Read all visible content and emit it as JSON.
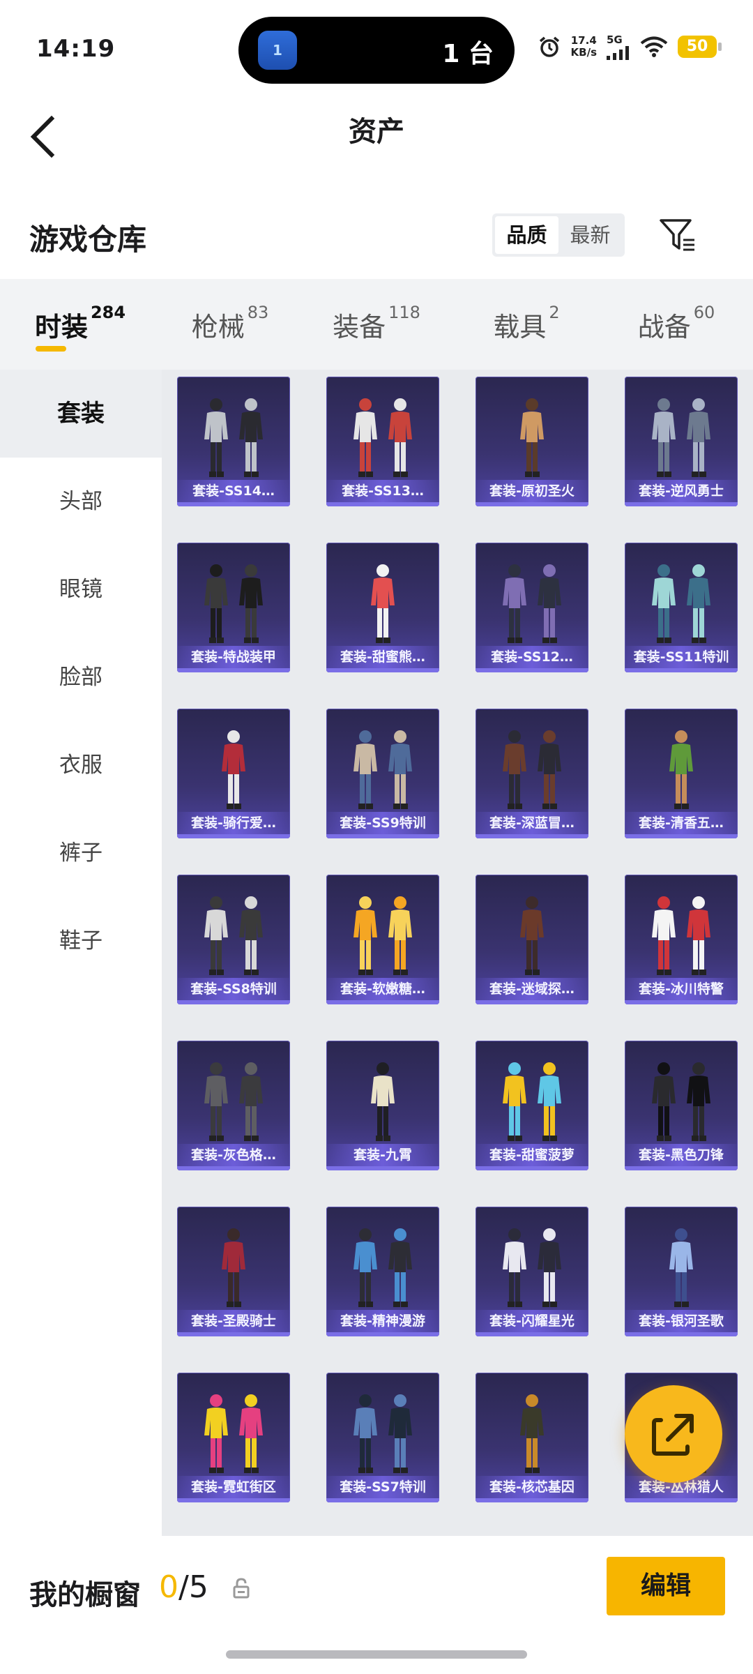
{
  "status_bar": {
    "time": "14:19",
    "island_badge": "1",
    "island_text": "1 台",
    "net_speed_value": "17.4",
    "net_speed_unit": "KB/s",
    "network": "5G",
    "battery": "50"
  },
  "header": {
    "title": "资产"
  },
  "warehouse": {
    "title": "游戏仓库",
    "sort_options": [
      "品质",
      "最新"
    ],
    "sort_active": "品质"
  },
  "tabs": [
    {
      "label": "时装",
      "count": "284",
      "active": true
    },
    {
      "label": "枪械",
      "count": "83",
      "active": false
    },
    {
      "label": "装备",
      "count": "118",
      "active": false
    },
    {
      "label": "载具",
      "count": "2",
      "active": false
    },
    {
      "label": "战备",
      "count": "60",
      "active": false
    }
  ],
  "sidebar": {
    "items": [
      {
        "label": "套装",
        "active": true
      },
      {
        "label": "头部",
        "active": false
      },
      {
        "label": "眼镜",
        "active": false
      },
      {
        "label": "脸部",
        "active": false
      },
      {
        "label": "衣服",
        "active": false
      },
      {
        "label": "裤子",
        "active": false
      },
      {
        "label": "鞋子",
        "active": false
      }
    ]
  },
  "items": [
    {
      "label": "套装-SS14…",
      "colors": [
        "#bfc3c9",
        "#2a2a30"
      ]
    },
    {
      "label": "套装-SS13…",
      "colors": [
        "#e6e6e6",
        "#c8433b"
      ]
    },
    {
      "label": "套装-原初圣火",
      "colors": [
        "#cf9a63",
        "#5a3b2a"
      ]
    },
    {
      "label": "套装-逆风勇士",
      "colors": [
        "#a9b3c6",
        "#6d7a8f"
      ]
    },
    {
      "label": "套装-特战装甲",
      "colors": [
        "#3a3a3a",
        "#1d1d1d"
      ]
    },
    {
      "label": "套装-甜蜜熊…",
      "colors": [
        "#e35050",
        "#f2f2f2"
      ]
    },
    {
      "label": "套装-SS12…",
      "colors": [
        "#7f6eb3",
        "#2d3140"
      ]
    },
    {
      "label": "套装-SS11特训",
      "colors": [
        "#9ed6d6",
        "#3c6f8a"
      ]
    },
    {
      "label": "套装-骑行爱…",
      "colors": [
        "#b32d3a",
        "#e8e8e8"
      ]
    },
    {
      "label": "套装-SS9特训",
      "colors": [
        "#c9b9a4",
        "#4f6b9a"
      ]
    },
    {
      "label": "套装-深蓝冒…",
      "colors": [
        "#6a3d2d",
        "#2b2b35"
      ]
    },
    {
      "label": "套装-清香五…",
      "colors": [
        "#5f9a3a",
        "#c58d5a"
      ]
    },
    {
      "label": "套装-SS8特训",
      "colors": [
        "#d8d8d8",
        "#3a3a3a"
      ]
    },
    {
      "label": "套装-软嫩糖…",
      "colors": [
        "#f5a623",
        "#f7d25a"
      ]
    },
    {
      "label": "套装-迷域探…",
      "colors": [
        "#6b3a2a",
        "#3d2b2b"
      ]
    },
    {
      "label": "套装-冰川特警",
      "colors": [
        "#f4f4f4",
        "#d0353a"
      ]
    },
    {
      "label": "套装-灰色格…",
      "colors": [
        "#5e5e62",
        "#3b3b3e"
      ]
    },
    {
      "label": "套装-九霄",
      "colors": [
        "#e9e2c8",
        "#1f1f24"
      ]
    },
    {
      "label": "套装-甜蜜菠萝",
      "colors": [
        "#f2c21f",
        "#5fc7e6"
      ]
    },
    {
      "label": "套装-黑色刀锋",
      "colors": [
        "#2a2a2e",
        "#111114"
      ]
    },
    {
      "label": "套装-圣殿骑士",
      "colors": [
        "#a02a3a",
        "#3a2a2a"
      ]
    },
    {
      "label": "套装-精神漫游",
      "colors": [
        "#4a8fd0",
        "#2d2d35"
      ]
    },
    {
      "label": "套装-闪耀星光",
      "colors": [
        "#e8e8f0",
        "#2b2b3a"
      ]
    },
    {
      "label": "套装-银河圣歌",
      "colors": [
        "#9ab6e8",
        "#3e4f8e"
      ]
    },
    {
      "label": "套装-霓虹街区",
      "colors": [
        "#f2d021",
        "#e54080"
      ]
    },
    {
      "label": "套装-SS7特训",
      "colors": [
        "#5a7fb8",
        "#1f2a3a"
      ]
    },
    {
      "label": "套装-核芯基因",
      "colors": [
        "#3a3a2a",
        "#c98a2a"
      ]
    },
    {
      "label": "套装-丛林猎人",
      "colors": [
        "#6a7a3a",
        "#3a3a2a"
      ]
    }
  ],
  "bottom_bar": {
    "title": "我的橱窗",
    "used": "0",
    "sep_total": "/5",
    "edit_label": "编辑"
  },
  "colors": {
    "accent": "#f5b800",
    "card_bg": "#3a3370",
    "card_label": "#6e5fdc"
  },
  "icons": {
    "back": "chevron-left-icon",
    "filter": "filter-icon",
    "share": "share-out-icon",
    "lock": "lock-icon",
    "alarm": "alarm-icon",
    "wifi": "wifi-icon",
    "hotspot": "hotspot-icon"
  }
}
